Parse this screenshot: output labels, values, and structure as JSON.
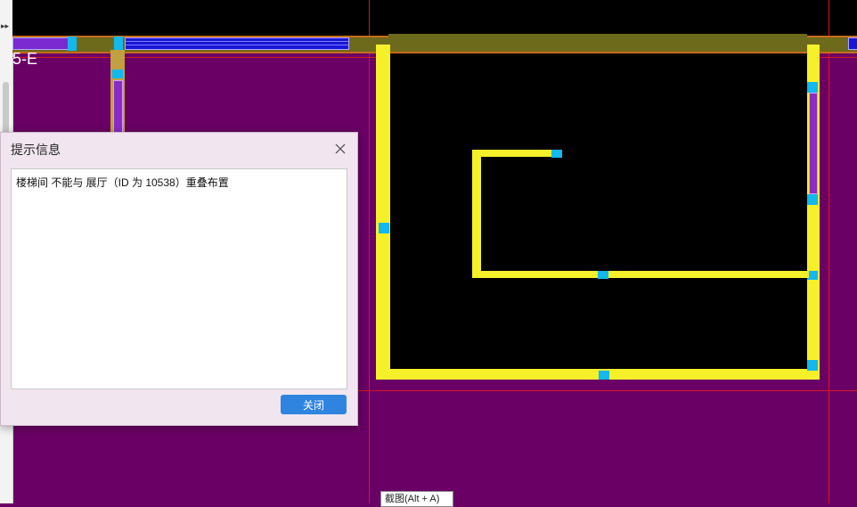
{
  "canvas": {
    "axis_label": "5-E",
    "colors": {
      "background": "#6a0066",
      "room_fill": "#000000",
      "wall_yellow": "#f6f02a",
      "node_cyan": "#12b8ee",
      "guide_red": "#d8141e",
      "wall_blue": "#1a16d8",
      "wall_olive": "#6e6a1c"
    }
  },
  "dialog": {
    "title": "提示信息",
    "message": "楼梯间 不能与 展厅（ID 为 10538）重叠布置",
    "close_button": "关闭",
    "close_icon": "close-icon"
  },
  "tooltip": {
    "text": "截图(Alt + A)"
  }
}
